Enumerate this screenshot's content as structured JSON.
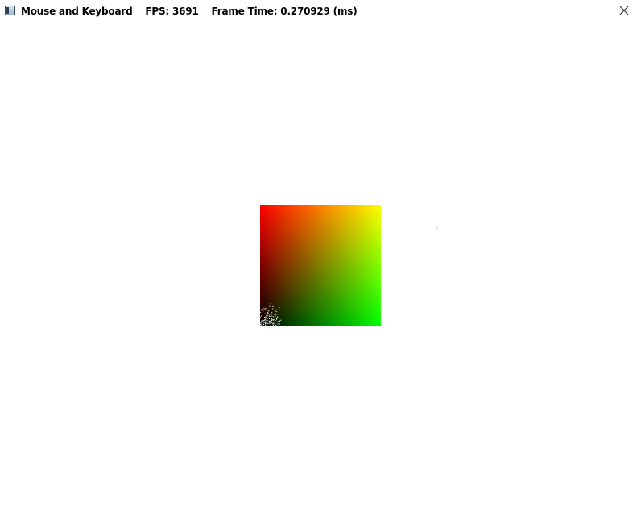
{
  "window": {
    "title": "Mouse and Keyboard    FPS: 3691    Frame Time: 0.270929 (ms)",
    "icon": "app-window-icon",
    "close_icon": "close-icon",
    "background_color": "#ffffff"
  },
  "scene": {
    "quad_corner_colors": {
      "top_left": "#ff0000",
      "top_right": "#ffff00",
      "bottom_left": "#000000",
      "bottom_right": "#00ff00"
    },
    "noise_color": "#ffffff"
  }
}
